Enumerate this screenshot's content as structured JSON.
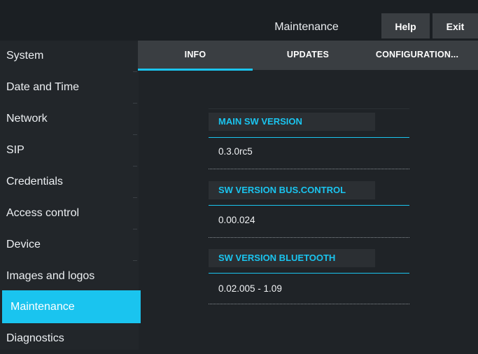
{
  "header": {
    "title": "Maintenance",
    "help_label": "Help",
    "exit_label": "Exit"
  },
  "sidebar": {
    "items": [
      {
        "label": "System"
      },
      {
        "label": "Date and Time"
      },
      {
        "label": "Network"
      },
      {
        "label": "SIP"
      },
      {
        "label": "Credentials"
      },
      {
        "label": "Access control"
      },
      {
        "label": "Device"
      },
      {
        "label": "Images and logos"
      },
      {
        "label": "Maintenance"
      },
      {
        "label": "Diagnostics"
      }
    ],
    "active": "Maintenance"
  },
  "tabs": {
    "items": [
      {
        "label": "INFO"
      },
      {
        "label": "UPDATES"
      },
      {
        "label": "CONFIGURATION..."
      }
    ],
    "active": "INFO"
  },
  "info": {
    "sections": [
      {
        "header": "MAIN SW VERSION",
        "value": "0.3.0rc5"
      },
      {
        "header": "SW VERSION BUS.CONTROL",
        "value": "0.00.024"
      },
      {
        "header": "SW VERSION BLUETOOTH",
        "value": "0.02.005 - 1.09"
      }
    ]
  },
  "colors": {
    "accent": "#1ac4ef",
    "background": "#1f2327",
    "panel": "#3a3e42"
  }
}
